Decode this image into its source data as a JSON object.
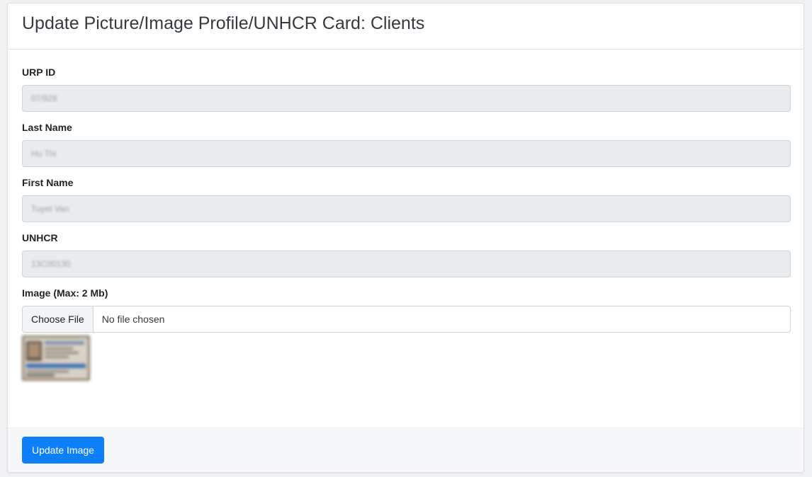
{
  "header": {
    "title": "Update Picture/Image Profile/UNHCR Card: Clients"
  },
  "form": {
    "urp_id": {
      "label": "URP ID",
      "value": "07/928"
    },
    "last_name": {
      "label": "Last Name",
      "value": "Hu Thi"
    },
    "first_name": {
      "label": "First Name",
      "value": "Tuyet Van"
    },
    "unhcr": {
      "label": "UNHCR",
      "value": "13C00130"
    },
    "image": {
      "label": "Image (Max: 2 Mb)",
      "button_label": "Choose File",
      "status": "No file chosen"
    }
  },
  "footer": {
    "submit_label": "Update Image"
  },
  "colors": {
    "primary": "#0d7ff9",
    "readonly_bg": "#e9ecef"
  }
}
